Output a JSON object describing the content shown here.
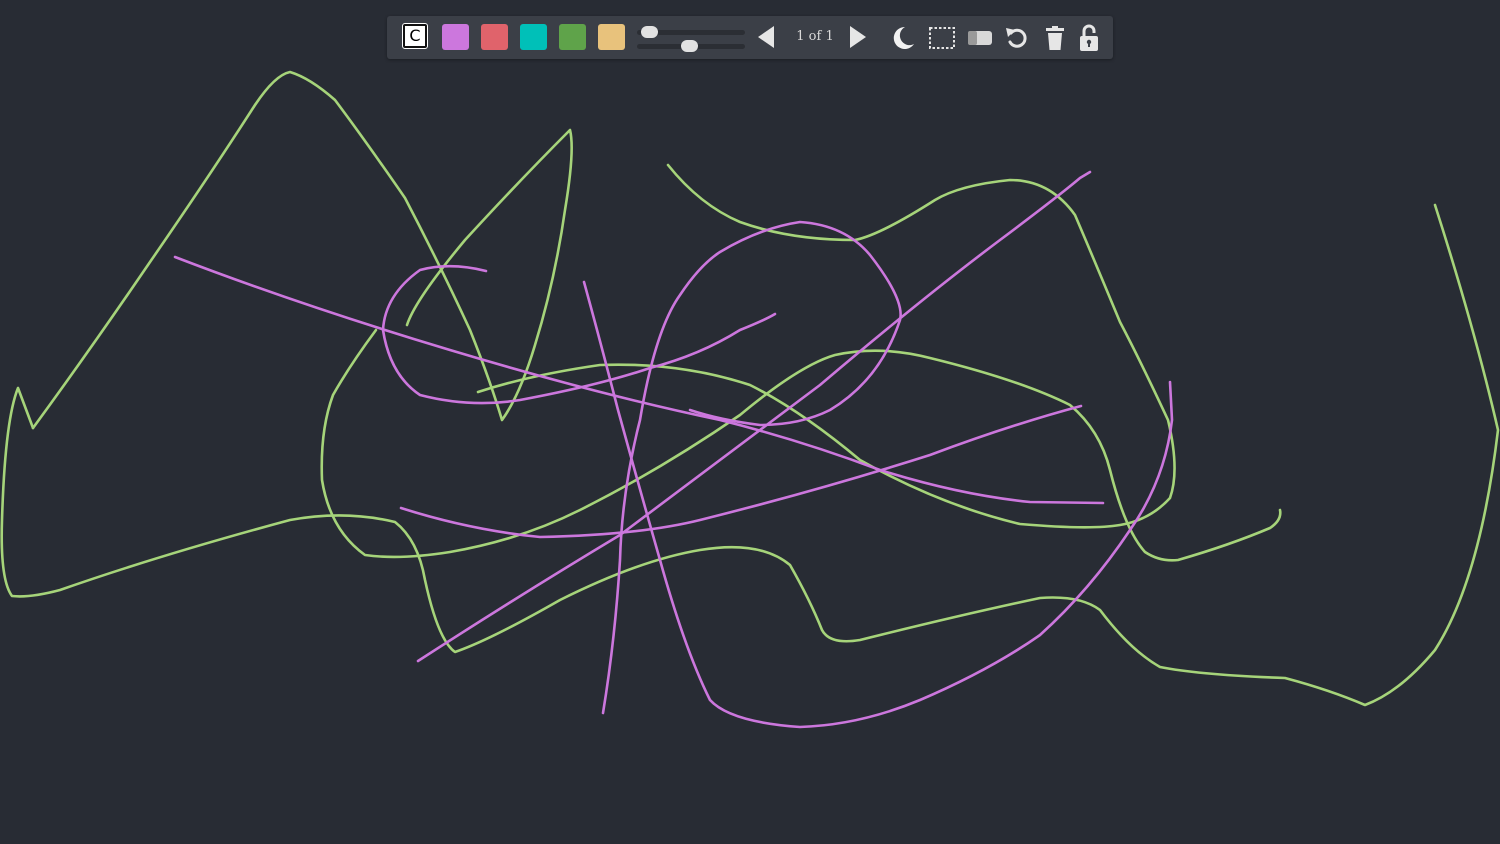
{
  "toolbar": {
    "clear_label": "C",
    "colors": [
      "#cc77dd",
      "#e0636b",
      "#00c0b8",
      "#5fa34a",
      "#e8c27c"
    ],
    "page_indicator": "1 of 1",
    "prev_icon": "triangle-left-icon",
    "next_icon": "triangle-right-icon",
    "theme_icon": "moon-icon",
    "select_icon": "dashed-rectangle-select-icon",
    "eraser_icon": "eraser-icon",
    "undo_icon": "undo-icon",
    "trash_icon": "trash-icon",
    "lock_icon": "unlocked-padlock-icon"
  },
  "canvas": {
    "background": "#282c34",
    "stroke_colors": {
      "green": "#a6d47a",
      "purple": "#cc77dd"
    }
  }
}
